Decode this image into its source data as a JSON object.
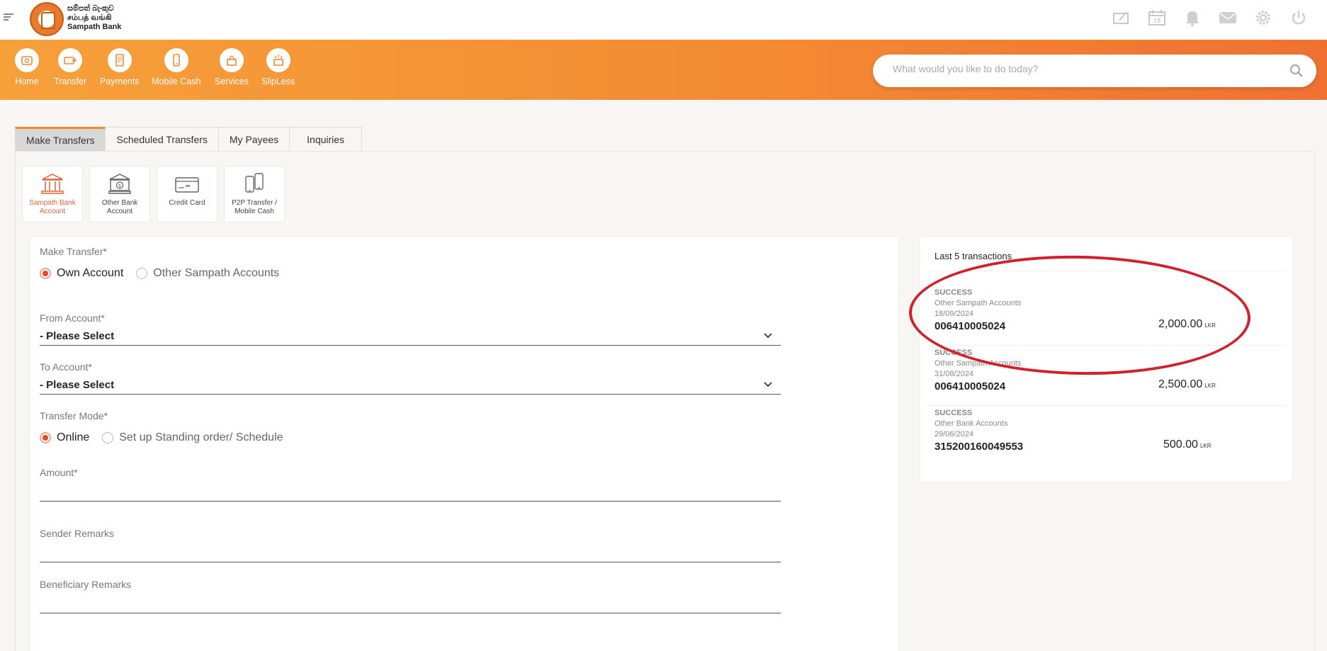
{
  "brand": {
    "line1": "සම්පත් බැංකුව",
    "line2": "சம்பத் வங்கி",
    "line3": "Sampath Bank"
  },
  "top_icons": [
    "edit-card-icon",
    "calendar-icon",
    "bell-icon",
    "mail-icon",
    "gear-icon",
    "power-icon"
  ],
  "calendar_day": "18",
  "nav": {
    "items": [
      {
        "label": "Home",
        "icon": "home-icon"
      },
      {
        "label": "Transfer",
        "icon": "transfer-icon"
      },
      {
        "label": "Payments",
        "icon": "payments-icon"
      },
      {
        "label": "Mobile Cash",
        "icon": "mobile-cash-icon"
      },
      {
        "label": "Services",
        "icon": "services-icon"
      },
      {
        "label": "SlipLess",
        "icon": "slipless-icon"
      }
    ]
  },
  "search": {
    "placeholder": "What would you like to do today?"
  },
  "tabs": [
    {
      "label": "Make Transfers",
      "active": true
    },
    {
      "label": "Scheduled Transfers"
    },
    {
      "label": "My Payees"
    },
    {
      "label": "Inquiries"
    }
  ],
  "transfer_types": [
    {
      "label_l1": "Sampath Bank",
      "label_l2": "Account",
      "active": true
    },
    {
      "label_l1": "Other Bank",
      "label_l2": "Account"
    },
    {
      "label_l1": "Credit Card",
      "label_l2": ""
    },
    {
      "label_l1": "P2P Transfer /",
      "label_l2": "Mobile Cash"
    }
  ],
  "form": {
    "make_transfer_label": "Make Transfer*",
    "own_account": "Own Account",
    "other_accounts": "Other Sampath Accounts",
    "from_label": "From Account*",
    "from_value": "- Please Select",
    "to_label": "To Account*",
    "to_value": "- Please Select",
    "mode_label": "Transfer Mode*",
    "mode_online": "Online",
    "mode_standing": "Set up Standing order/ Schedule",
    "amount_label": "Amount*",
    "sender_label": "Sender Remarks",
    "beneficiary_label": "Beneficiary Remarks"
  },
  "transactions": {
    "title": "Last 5 transactions",
    "items": [
      {
        "status": "SUCCESS",
        "type": "Other Sampath Accounts",
        "date": "18/09/2024",
        "account": "006410005024",
        "amount": "2,000.00",
        "currency": "LKR"
      },
      {
        "status": "SUCCESS",
        "type": "Other Sampath Accounts",
        "date": "31/08/2024",
        "account": "006410005024",
        "amount": "2,500.00",
        "currency": "LKR"
      },
      {
        "status": "SUCCESS",
        "type": "Other Bank Accounts",
        "date": "29/06/2024",
        "account": "315200160049553",
        "amount": "500.00",
        "currency": "LKR"
      }
    ]
  },
  "colors": {
    "accent": "#f08a2c",
    "annotation": "#d21f2b",
    "radio_on": "#e8452a"
  }
}
